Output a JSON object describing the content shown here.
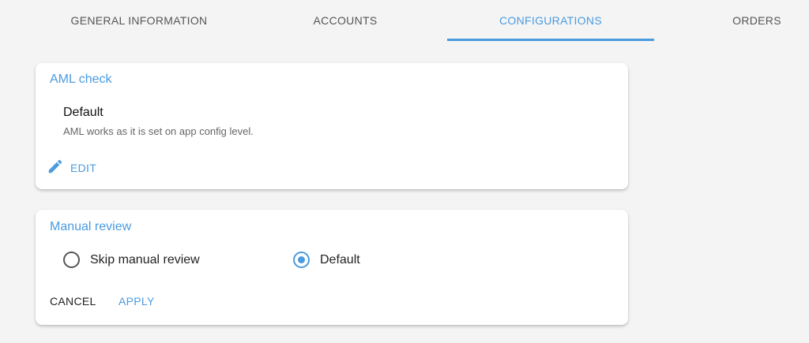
{
  "tabs": [
    {
      "label": "GENERAL INFORMATION"
    },
    {
      "label": "ACCOUNTS"
    },
    {
      "label": "CONFIGURATIONS",
      "active": true
    },
    {
      "label": "ORDERS"
    }
  ],
  "aml_card": {
    "title": "AML check",
    "option_name": "Default",
    "option_description": "AML works as it is set on app config level.",
    "edit_label": "EDIT",
    "edit_icon": "pencil-icon"
  },
  "manual_review_card": {
    "title": "Manual review",
    "options": [
      {
        "label": "Skip manual review",
        "selected": false
      },
      {
        "label": "Default",
        "selected": true
      }
    ],
    "cancel_label": "CANCEL",
    "apply_label": "APPLY"
  },
  "colors": {
    "accent": "#4a9be0",
    "background": "#f4f4f4",
    "card": "#ffffff"
  }
}
